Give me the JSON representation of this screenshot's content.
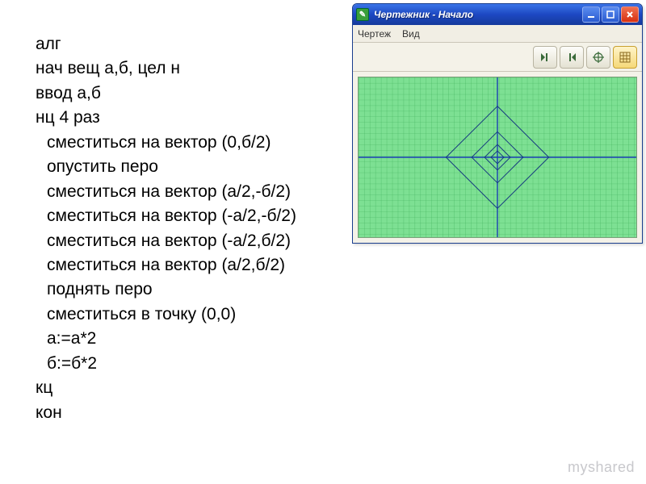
{
  "code": {
    "lines": [
      {
        "text": "алг",
        "indent": false
      },
      {
        "text": "нач вещ а,б, цел н",
        "indent": false
      },
      {
        "text": "ввод а,б",
        "indent": false
      },
      {
        "text": "нц 4 раз",
        "indent": false
      },
      {
        "text": "сместиться на вектор (0,б/2)",
        "indent": true
      },
      {
        "text": "опустить перо",
        "indent": true
      },
      {
        "text": "сместиться на вектор (а/2,-б/2)",
        "indent": true
      },
      {
        "text": "сместиться на вектор (-а/2,-б/2)",
        "indent": true
      },
      {
        "text": "сместиться на вектор (-а/2,б/2)",
        "indent": true
      },
      {
        "text": "сместиться на вектор (а/2,б/2)",
        "indent": true
      },
      {
        "text": "поднять перо",
        "indent": true
      },
      {
        "text": "сместиться в точку (0,0)",
        "indent": true
      },
      {
        "text": "а:=а*2",
        "indent": true
      },
      {
        "text": "б:=б*2",
        "indent": true
      },
      {
        "text": "кц",
        "indent": false
      },
      {
        "text": "кон",
        "indent": false
      }
    ]
  },
  "window": {
    "title": "Чертежник - Начало",
    "menu": {
      "item1": "Чертеж",
      "item2": "Вид"
    }
  },
  "watermark": "myshared"
}
